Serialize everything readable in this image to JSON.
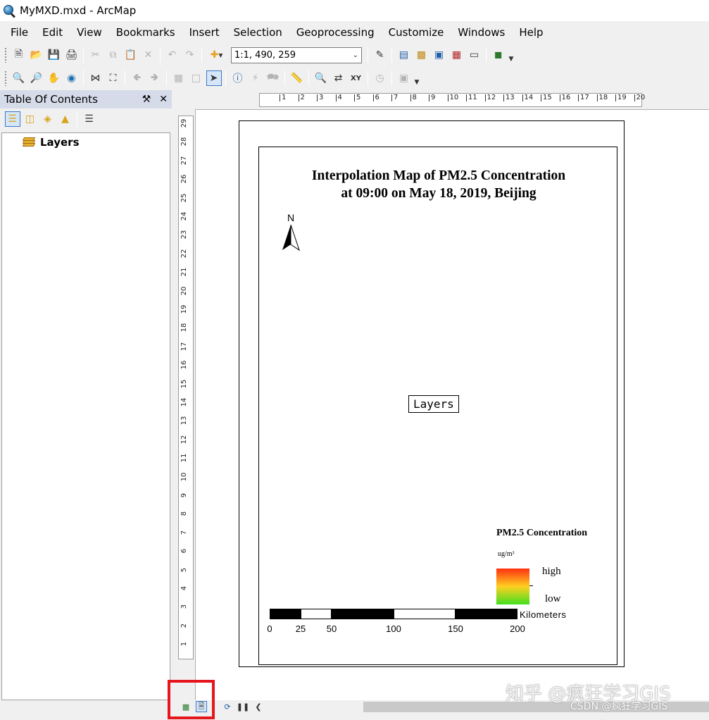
{
  "window": {
    "title": "MyMXD.mxd - ArcMap"
  },
  "menu": [
    "File",
    "Edit",
    "View",
    "Bookmarks",
    "Insert",
    "Selection",
    "Geoprocessing",
    "Customize",
    "Windows",
    "Help"
  ],
  "toolbar": {
    "scale_value": "1:1, 490, 259"
  },
  "toc": {
    "title": "Table Of Contents",
    "pin_icon": "pin-icon",
    "close_icon": "close-icon",
    "layer_name": "Layers"
  },
  "rulers": {
    "horizontal": [
      "1",
      "2",
      "3",
      "4",
      "5",
      "6",
      "7",
      "8",
      "9",
      "10",
      "11",
      "12",
      "13",
      "14",
      "15",
      "16",
      "17",
      "18",
      "19",
      "20"
    ],
    "vertical": [
      "29",
      "28",
      "27",
      "26",
      "25",
      "24",
      "23",
      "22",
      "21",
      "20",
      "19",
      "18",
      "17",
      "16",
      "15",
      "14",
      "13",
      "12",
      "11",
      "10",
      "9",
      "8",
      "7",
      "6",
      "5",
      "4",
      "3",
      "2",
      "1"
    ]
  },
  "map_layout": {
    "title_line1": "Interpolation Map of PM2.5 Concentration",
    "title_line2": "at 09:00 on May 18, 2019, Beijing",
    "north_label": "N",
    "data_frame_label": "Layers",
    "legend": {
      "title": "PM2.5 Concentration",
      "unit": "ug/m³",
      "high": "high",
      "low": "low",
      "ramp_colors": [
        "#ff3010",
        "#ffd020",
        "#40e020"
      ]
    },
    "scalebar": {
      "unit": "Kilometers",
      "labels": [
        "0",
        "25",
        "50",
        "100",
        "150",
        "200"
      ]
    }
  },
  "watermark": {
    "main": "知乎 @疯狂学习GIS",
    "sub": "CSDN @疯狂学习GIS"
  },
  "colors": {
    "highlight": "#e5171d",
    "toc_header": "#d6dbe9",
    "active_tool": "#3b79c4"
  }
}
